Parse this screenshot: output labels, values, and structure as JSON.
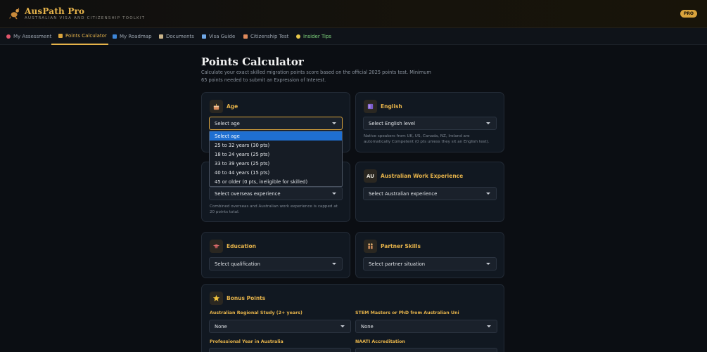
{
  "header": {
    "brand": "AusPath Pro",
    "tagline": "AUSTRALIAN VISA AND CITIZENSHIP TOOLKIT",
    "badge": "PRO",
    "logo_icon": "kangaroo-icon"
  },
  "tabs": [
    {
      "label": "My Assessment",
      "icon": "target-icon",
      "icon_color": "#e0556b"
    },
    {
      "label": "Points Calculator",
      "icon": "chart-icon",
      "icon_color": "#d9a33c",
      "active": true
    },
    {
      "label": "My Roadmap",
      "icon": "map-icon",
      "icon_color": "#3d86d8"
    },
    {
      "label": "Documents",
      "icon": "clipboard-icon",
      "icon_color": "#c9b48a"
    },
    {
      "label": "Visa Guide",
      "icon": "plane-icon",
      "icon_color": "#6fa7e6"
    },
    {
      "label": "Citizenship Test",
      "icon": "page-icon",
      "icon_color": "#e08a5c"
    },
    {
      "label": "Insider Tips",
      "icon": "bulb-icon",
      "icon_color": "#e6c64a",
      "highlight": true
    }
  ],
  "main": {
    "title": "Points Calculator",
    "description": "Calculate your exact skilled migration points score based on the official 2025 points test. Minimum 65 points needed to submit an Expression of Interest."
  },
  "cards": {
    "age": {
      "title": "Age",
      "icon": "birthday-cake-icon",
      "select": "Select age"
    },
    "english": {
      "title": "English",
      "icon": "book-icon",
      "select": "Select English level",
      "note": "Native speakers from UK, US, Canada, NZ, Ireland are automatically Competent (0 pts unless they sit an English test)."
    },
    "overseas": {
      "select": "Select overseas experience",
      "note": "Combined overseas and Australian work experience is capped at 20 points total."
    },
    "aus_work": {
      "title": "Australian Work Experience",
      "icon_text": "AU",
      "select": "Select Australian experience"
    },
    "education": {
      "title": "Education",
      "icon": "graduation-icon",
      "select": "Select qualification"
    },
    "partner": {
      "title": "Partner Skills",
      "icon": "couple-icon",
      "select": "Select partner situation"
    },
    "bonus": {
      "title": "Bonus Points",
      "icon": "star-icon",
      "fields": [
        {
          "label": "Australian Regional Study (2+ years)",
          "value": "None"
        },
        {
          "label": "STEM Masters or PhD from Australian Uni",
          "value": "None"
        },
        {
          "label": "Professional Year in Australia",
          "value": ""
        },
        {
          "label": "NAATI Accreditation",
          "value": ""
        }
      ]
    }
  },
  "age_dropdown": {
    "options": [
      "Select age",
      "25 to 32 years (30 pts)",
      "18 to 24 years (25 pts)",
      "33 to 39 years (25 pts)",
      "40 to 44 years (15 pts)",
      "45 or older (0 pts, ineligible for skilled)"
    ],
    "selected_index": 0
  },
  "colors": {
    "accent": "#e6b34a",
    "background": "#0b0e13",
    "card": "#111821",
    "selected_option": "#1f6fd1",
    "tip_green": "#7ed37c"
  }
}
